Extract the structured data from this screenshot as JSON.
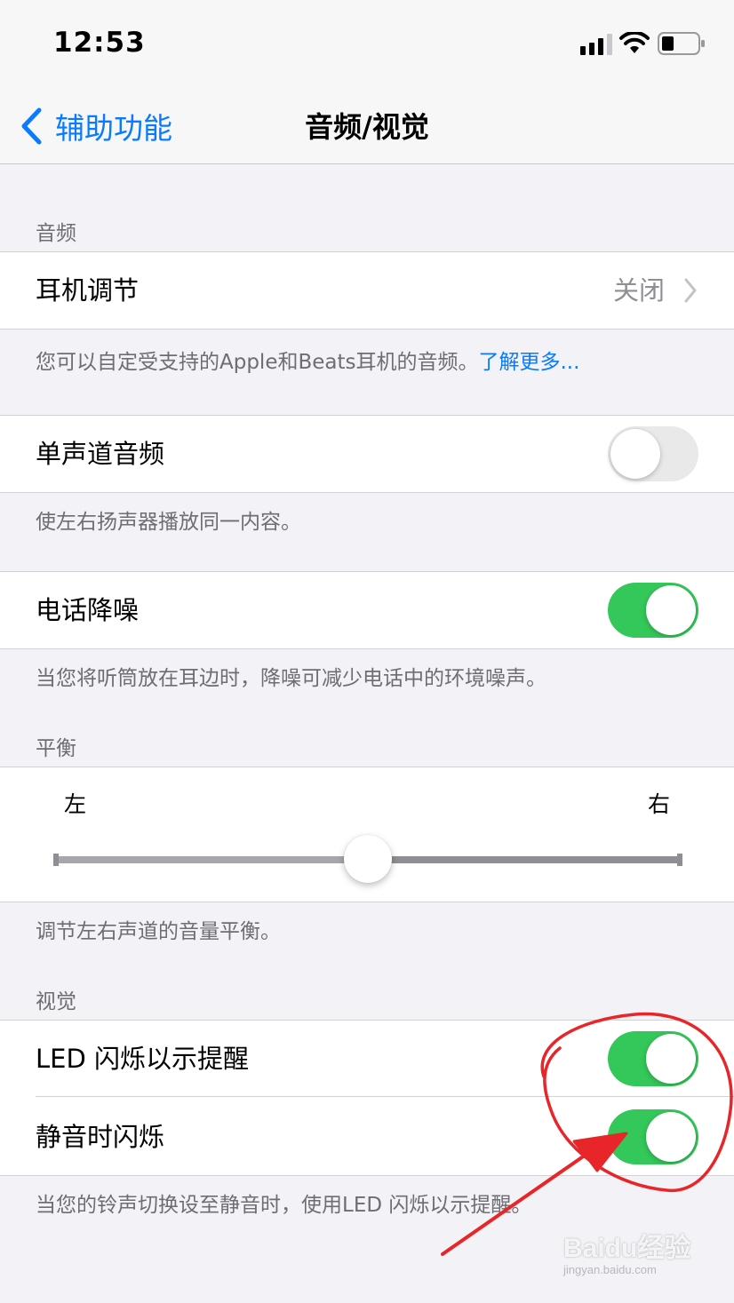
{
  "status_bar": {
    "time": "12:53"
  },
  "nav": {
    "back_label": "辅助功能",
    "title": "音频/视觉"
  },
  "audio": {
    "header": "音频",
    "headphone": {
      "label": "耳机调节",
      "value": "关闭"
    },
    "headphone_footer": "您可以自定受支持的Apple和Beats耳机的音频。",
    "headphone_footer_link": "了解更多...",
    "mono": {
      "label": "单声道音频",
      "on": false
    },
    "mono_footer": "使左右扬声器播放同一内容。",
    "noise": {
      "label": "电话降噪",
      "on": true
    },
    "noise_footer": "当您将听筒放在耳边时，降噪可减少电话中的环境噪声。"
  },
  "balance": {
    "header": "平衡",
    "left_label": "左",
    "right_label": "右",
    "value_fraction": 0.5,
    "footer": "调节左右声道的音量平衡。"
  },
  "visual": {
    "header": "视觉",
    "led_flash": {
      "label": "LED 闪烁以示提醒",
      "on": true
    },
    "flash_silent": {
      "label": "静音时闪烁",
      "on": true
    },
    "footer": "当您的铃声切换设至静音时，使用LED 闪烁以示提醒。"
  },
  "colors": {
    "accent": "#0a7aff",
    "toggle_on": "#34c759",
    "annotation": "#e8262a"
  },
  "watermark": {
    "brand": "Baidu经验",
    "url": "jingyan.baidu.com"
  }
}
